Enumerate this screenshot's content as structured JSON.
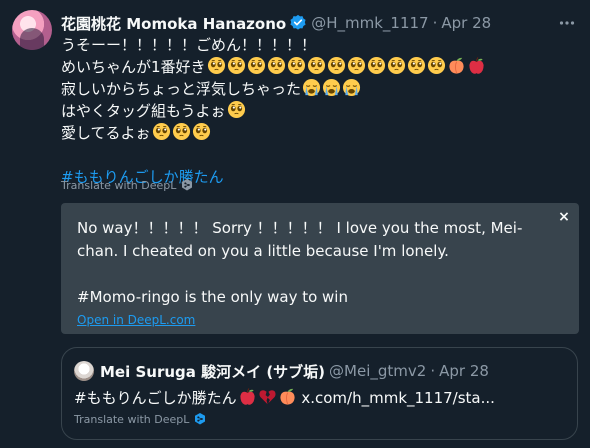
{
  "author": {
    "display_name": "花園桃花 Momoka Hanazono",
    "handle": "@H_mmk_1117",
    "separator": "·",
    "date": "Apr 28"
  },
  "tweet": {
    "lines": [
      "うそーー！！！！！ごめん！！！！！",
      "めいちゃんが1番好き",
      "寂しいからちょっと浮気しちゃった",
      "はやくタッグ組もうよぉ",
      "愛してるよぉ"
    ],
    "hashtag": "#ももりんごしか勝たん",
    "emoji_names": [
      "pleading-face",
      "loudly-crying-face",
      "peach",
      "apple"
    ]
  },
  "translate_label": "Translate with DeepL",
  "translation": {
    "paragraph1": "No way！！！！！ Sorry ！！！！！ I love you the most, Mei-chan. I cheated on you a little because I'm lonely.",
    "paragraph2": "#Momo-ringo is the only way to win",
    "open_link": "Open in DeepL.com",
    "close": "×"
  },
  "quote": {
    "display_name": "Mei Suruga 駿河メイ (サブ垢)",
    "handle": "@Mei_gtmv2",
    "separator": "·",
    "date": "Apr 28",
    "text": "#ももりんごしか勝たん",
    "link": "x.com/h_mmk_1117/sta...",
    "translate_label": "Translate with DeepL"
  },
  "colors": {
    "background": "#15202b",
    "text": "#f7f9f9",
    "muted": "#8b98a5",
    "link": "#1d9bf0",
    "translation_bg": "#38444d"
  }
}
